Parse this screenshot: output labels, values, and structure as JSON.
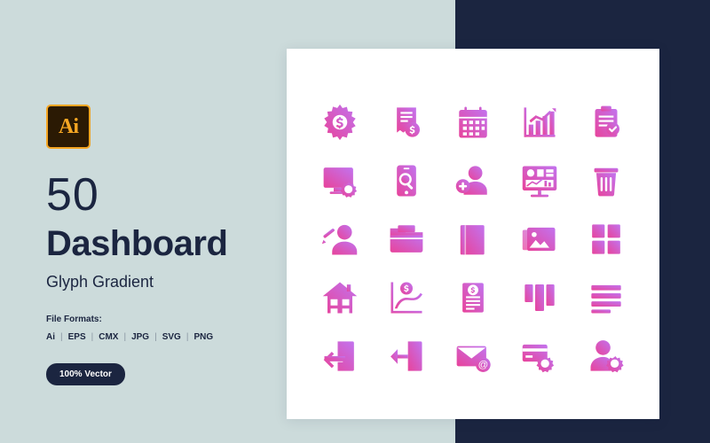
{
  "background": {
    "left_color": "#ccdbdb",
    "panel_color": "#1b2540",
    "card_color": "#ffffff"
  },
  "brand": {
    "badge_text": "Ai",
    "badge_bg": "#2b1a04",
    "badge_border": "#f5a623"
  },
  "headline": {
    "count": "50",
    "title": "Dashboard",
    "subtitle": "Glyph Gradient"
  },
  "formats": {
    "label": "File Formats:",
    "items": [
      "Ai",
      "EPS",
      "CMX",
      "JPG",
      "SVG",
      "PNG"
    ],
    "separator": "|"
  },
  "badge": {
    "vector_label": "100% Vector"
  },
  "gradient": {
    "start": "#e8439a",
    "end": "#c06cf0"
  },
  "icons": {
    "rows": 5,
    "columns": 5,
    "items": [
      "gear-dollar-icon",
      "invoice-dollar-icon",
      "calendar-icon",
      "bar-chart-growth-icon",
      "clipboard-check-icon",
      "monitor-settings-icon",
      "mobile-search-icon",
      "add-user-icon",
      "presentation-screen-icon",
      "trash-bin-icon",
      "user-checklist-icon",
      "open-folder-icon",
      "book-icon",
      "photo-gallery-icon",
      "layout-columns-icon",
      "home-icon",
      "line-chart-dollar-icon",
      "document-dollar-icon",
      "layout-grid-icon",
      "list-lines-icon",
      "login-arrow-icon",
      "logout-arrow-icon",
      "email-at-icon",
      "card-settings-icon",
      "user-settings-icon"
    ]
  }
}
